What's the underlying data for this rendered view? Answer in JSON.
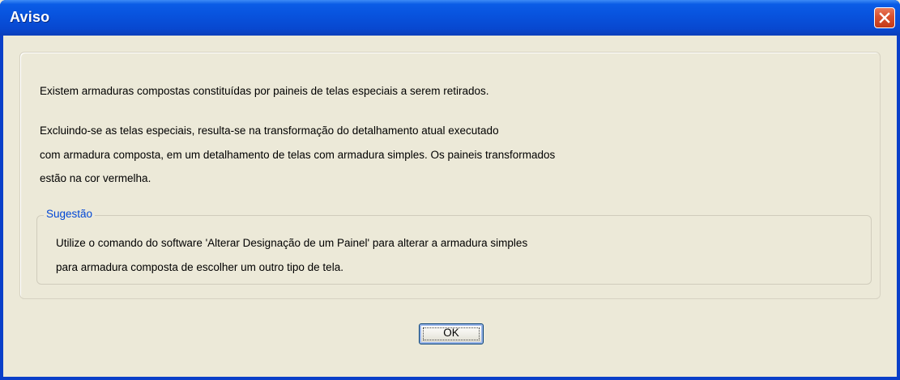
{
  "window": {
    "title": "Aviso"
  },
  "message": {
    "line1": "Existem armaduras compostas constituídas por paineis de telas especiais a serem retirados.",
    "line2": "Excluindo-se as telas especiais, resulta-se na transformação do detalhamento atual executado",
    "line3": "com armadura composta, em um detalhamento de telas com armadura simples. Os paineis transformados",
    "line4": "estão na cor vermelha."
  },
  "suggestion": {
    "legend": "Sugestão",
    "line1": "Utilize o comando do software 'Alterar Designação de um Painel' para alterar a armadura simples",
    "line2": "para armadura composta de escolher um outro tipo de tela."
  },
  "buttons": {
    "ok_label": "OK"
  },
  "colors": {
    "titlebar": "#0852dd",
    "close_button": "#d8502e",
    "dialog_background": "#ece9d8",
    "legend_text": "#0046d5"
  },
  "icons": {
    "close": "close-icon"
  }
}
